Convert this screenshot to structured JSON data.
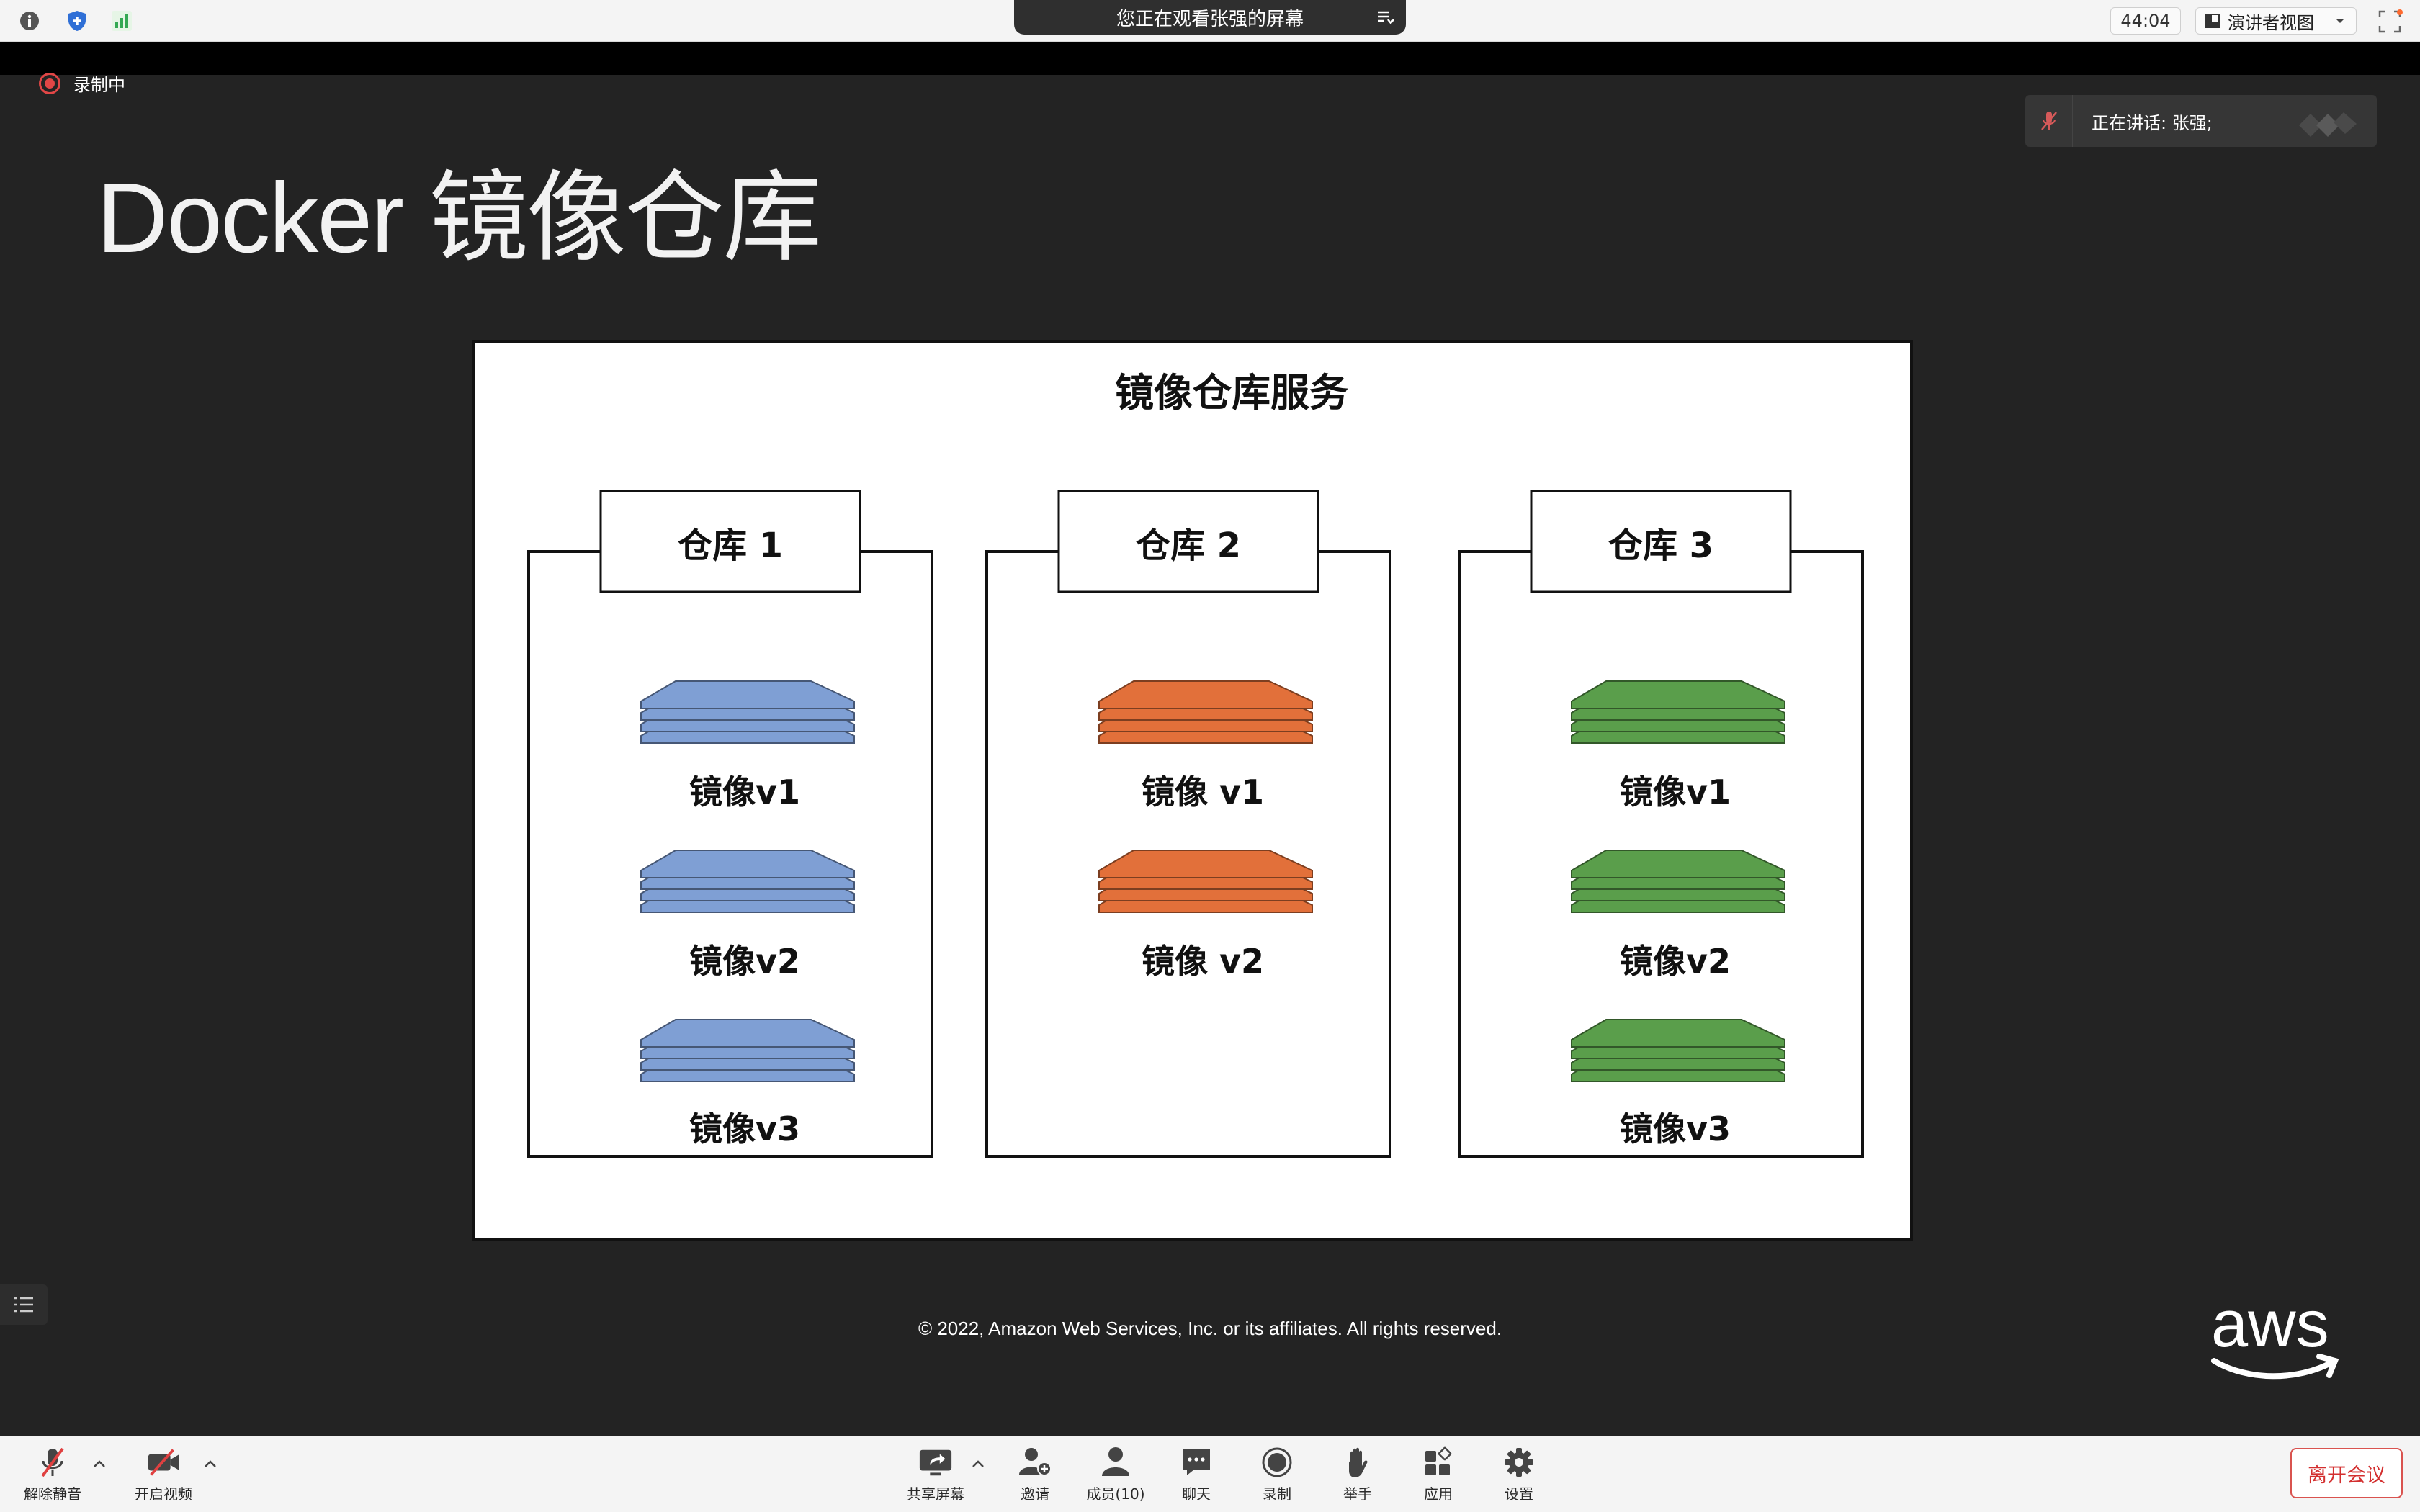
{
  "top_bar": {
    "share_banner": "您正在观看张强的屏幕",
    "timer": "44:04",
    "view_mode": "演讲者视图"
  },
  "recording_label": "录制中",
  "speaker_text": "正在讲话: 张强;",
  "slide": {
    "title": "Docker 镜像仓库",
    "diagram": {
      "title": "镜像仓库服务",
      "repositories": [
        {
          "name": "仓库 1",
          "color": "#7f9fd4",
          "images": [
            "镜像v1",
            "镜像v2",
            "镜像v3"
          ]
        },
        {
          "name": "仓库 2",
          "color": "#e2703a",
          "images": [
            "镜像 v1",
            "镜像 v2"
          ]
        },
        {
          "name": "仓库 3",
          "color": "#5a9e4b",
          "images": [
            "镜像v1",
            "镜像v2",
            "镜像v3"
          ]
        }
      ]
    },
    "copyright": "© 2022, Amazon Web Services, Inc. or its affiliates. All rights reserved.",
    "logo_text": "aws"
  },
  "toolbar": {
    "unmute": "解除静音",
    "start_video": "开启视频",
    "share_screen": "共享屏幕",
    "invite": "邀请",
    "participants": "成员(10)",
    "chat": "聊天",
    "record": "录制",
    "raise_hand": "举手",
    "apps": "应用",
    "settings": "设置",
    "leave": "离开会议"
  }
}
